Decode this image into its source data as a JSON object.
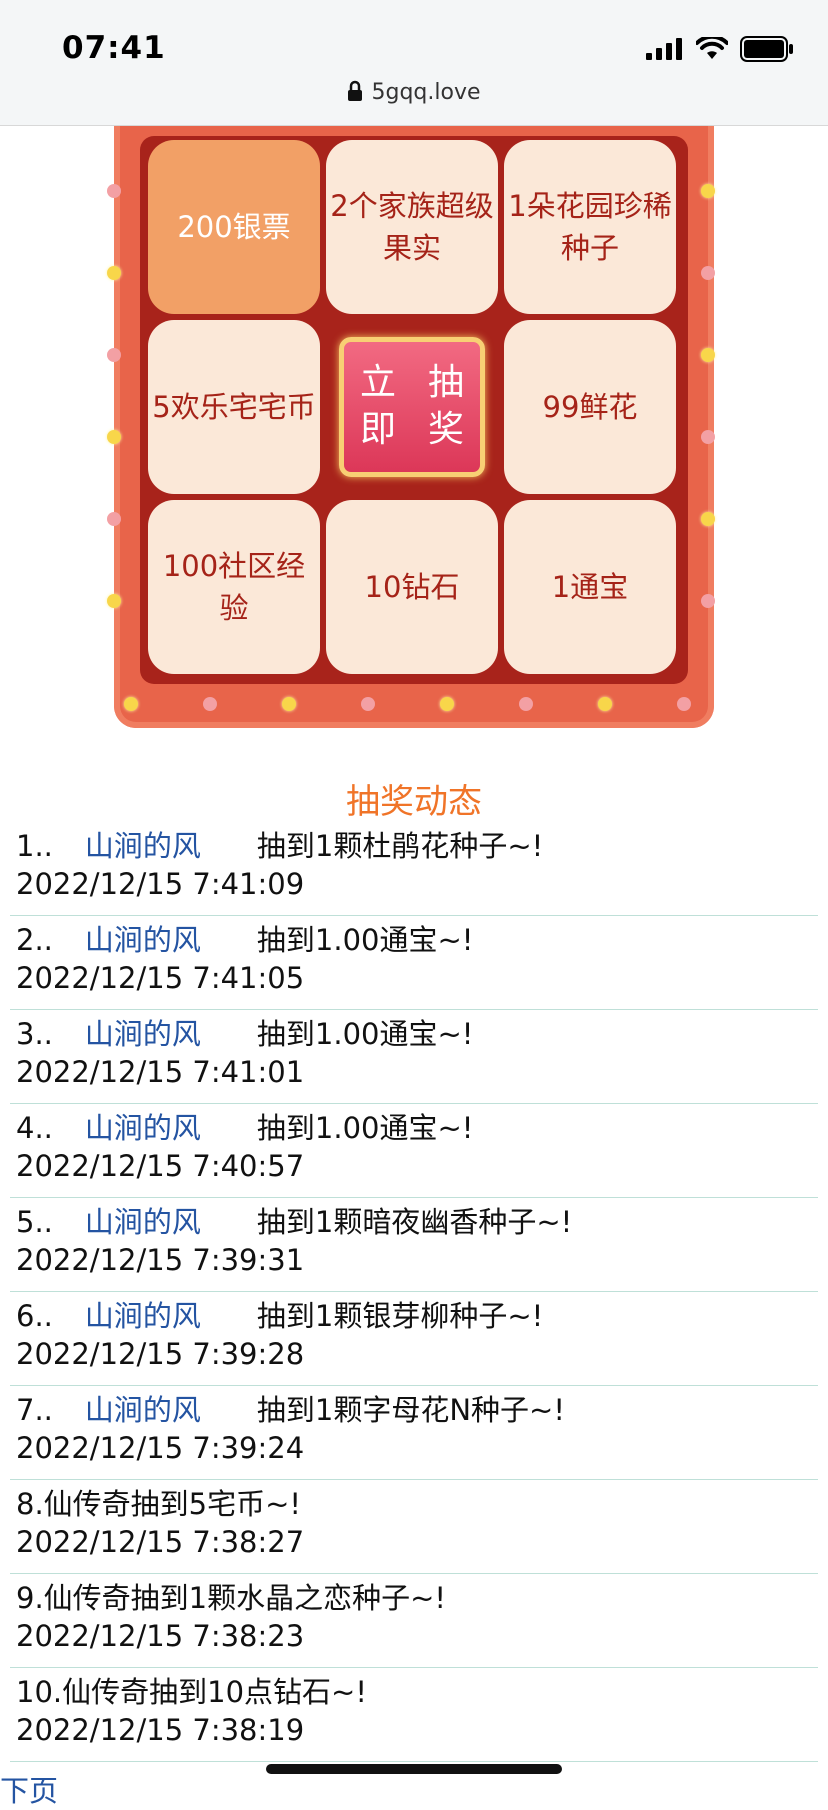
{
  "status_bar": {
    "time": "07:41"
  },
  "address_bar": {
    "url": "5gqq.love"
  },
  "lottery": {
    "prizes": [
      "200银票",
      "2个家族超级果实",
      "1朵花园珍稀种子",
      "5欢乐宅宅币",
      "99鲜花",
      "100社区经验",
      "10钻石",
      "1通宝"
    ],
    "draw_button": "立即抽奖"
  },
  "feed": {
    "title": "抽奖动态",
    "items": [
      {
        "num": "1..",
        "user": "山涧的风",
        "text": "抽到1颗杜鹃花种子~!",
        "time": "2022/12/15 7:41:09"
      },
      {
        "num": "2..",
        "user": "山涧的风",
        "text": "抽到1.00通宝~!",
        "time": "2022/12/15 7:41:05"
      },
      {
        "num": "3..",
        "user": "山涧的风",
        "text": "抽到1.00通宝~!",
        "time": "2022/12/15 7:41:01"
      },
      {
        "num": "4..",
        "user": "山涧的风",
        "text": "抽到1.00通宝~!",
        "time": "2022/12/15 7:40:57"
      },
      {
        "num": "5..",
        "user": "山涧的风",
        "text": "抽到1颗暗夜幽香种子~!",
        "time": "2022/12/15 7:39:31"
      },
      {
        "num": "6..",
        "user": "山涧的风",
        "text": "抽到1颗银芽柳种子~!",
        "time": "2022/12/15 7:39:28"
      },
      {
        "num": "7..",
        "user": "山涧的风",
        "text": "抽到1颗字母花N种子~!",
        "time": "2022/12/15 7:39:24"
      },
      {
        "num": "8.",
        "user": "",
        "text": "仙传奇抽到5宅币~!",
        "time": "2022/12/15 7:38:27"
      },
      {
        "num": "9.",
        "user": "",
        "text": "仙传奇抽到1颗水晶之恋种子~!",
        "time": "2022/12/15 7:38:23"
      },
      {
        "num": "10.",
        "user": "",
        "text": "仙传奇抽到10点钻石~!",
        "time": "2022/12/15 7:38:19"
      }
    ],
    "next_link": "下页"
  }
}
